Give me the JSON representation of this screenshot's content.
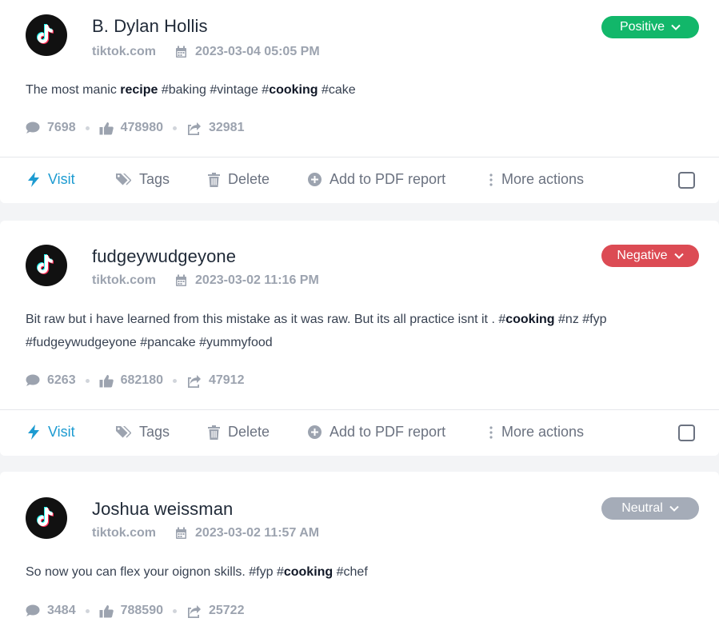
{
  "posts": [
    {
      "author": "B. Dylan Hollis",
      "source": "tiktok.com",
      "datetime": "2023-03-04 05:05 PM",
      "sentiment": "Positive",
      "text_parts": [
        {
          "t": "The most manic ",
          "b": false
        },
        {
          "t": "recipe",
          "b": true
        },
        {
          "t": " #baking #vintage #",
          "b": false
        },
        {
          "t": "cooking",
          "b": true
        },
        {
          "t": " #cake",
          "b": false
        }
      ],
      "comments": "7698",
      "likes": "478980",
      "shares": "32981"
    },
    {
      "author": "fudgeywudgeyone",
      "source": "tiktok.com",
      "datetime": "2023-03-02 11:16 PM",
      "sentiment": "Negative",
      "text_parts": [
        {
          "t": "Bit raw but i have learned from this mistake as it was raw. But its all practice isnt it . #",
          "b": false
        },
        {
          "t": "cooking",
          "b": true
        },
        {
          "t": " #nz #fyp #fudgeywudgeyone #pancake #yummyfood",
          "b": false
        }
      ],
      "comments": "6263",
      "likes": "682180",
      "shares": "47912"
    },
    {
      "author": "Joshua weissman",
      "source": "tiktok.com",
      "datetime": "2023-03-02 11:57 AM",
      "sentiment": "Neutral",
      "text_parts": [
        {
          "t": "So now you can flex your oignon skills. #fyp #",
          "b": false
        },
        {
          "t": "cooking",
          "b": true
        },
        {
          "t": " #chef",
          "b": false
        }
      ],
      "comments": "3484",
      "likes": "788590",
      "shares": "25722"
    }
  ],
  "actions": {
    "visit": "Visit",
    "tags": "Tags",
    "delete": "Delete",
    "add_pdf": "Add to PDF report",
    "more": "More actions"
  },
  "icons": {
    "avatar": "tiktok-logo-icon",
    "sentiment_toggle": "chevron-down-icon",
    "date": "calendar-icon",
    "comments": "comment-bubble-icon",
    "likes": "thumbs-up-icon",
    "shares": "share-icon",
    "visit": "lightning-bolt-icon",
    "tags": "tag-icon",
    "delete": "trash-icon",
    "add_pdf": "plus-circle-icon",
    "more": "vertical-dots-icon"
  },
  "colors": {
    "positive": "#12b76a",
    "negative": "#dc4b54",
    "neutral": "#a5acb8",
    "visit": "#1d9bd1"
  }
}
